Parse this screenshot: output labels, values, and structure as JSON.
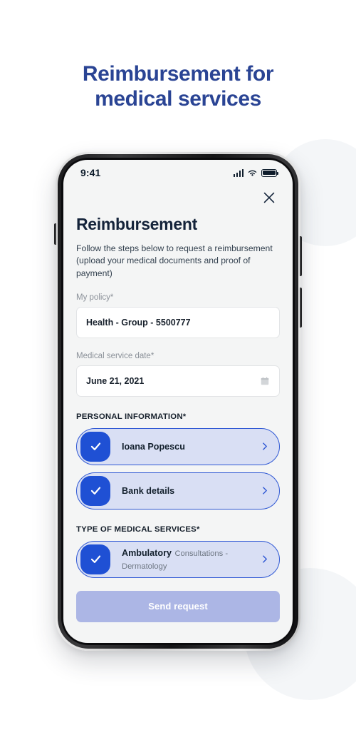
{
  "headline": {
    "line1": "Reimbursement for",
    "line2": "medical services",
    "color": "#2a4494"
  },
  "status_bar": {
    "time": "9:41",
    "signal_icon": "signal-bars-icon",
    "wifi_icon": "wifi-icon",
    "battery_icon": "battery-full-icon"
  },
  "screen": {
    "close_icon": "close-icon",
    "title": "Reimbursement",
    "description": "Follow the steps below to request a reimbursement (upload your medical documents and proof of payment)",
    "fields": [
      {
        "label": "My policy*",
        "value": "Health - Group - 5500777",
        "icon": ""
      },
      {
        "label": "Medical service date*",
        "value": "June 21, 2021",
        "icon": "calendar-icon"
      }
    ],
    "sections": [
      {
        "title": "PERSONAL INFORMATION*",
        "options": [
          {
            "title": "Ioana Popescu",
            "subtitle": "",
            "checked": true,
            "check_icon": "check-icon",
            "chevron_icon": "chevron-right-icon"
          },
          {
            "title": "Bank details",
            "subtitle": "",
            "checked": true,
            "check_icon": "check-icon",
            "chevron_icon": "chevron-right-icon"
          }
        ]
      },
      {
        "title": "TYPE OF MEDICAL SERVICES*",
        "options": [
          {
            "title": "Ambulatory",
            "subtitle": "Consultations - Dermatology",
            "checked": true,
            "check_icon": "check-icon",
            "chevron_icon": "chevron-right-icon"
          }
        ]
      }
    ],
    "submit_label": "Send request",
    "colors": {
      "accent": "#1f50d4",
      "option_border": "#2f58d4",
      "option_fill": "#d9dff4",
      "submit_bg": "#acb6e5",
      "screen_bg": "#f4f5f5"
    }
  }
}
